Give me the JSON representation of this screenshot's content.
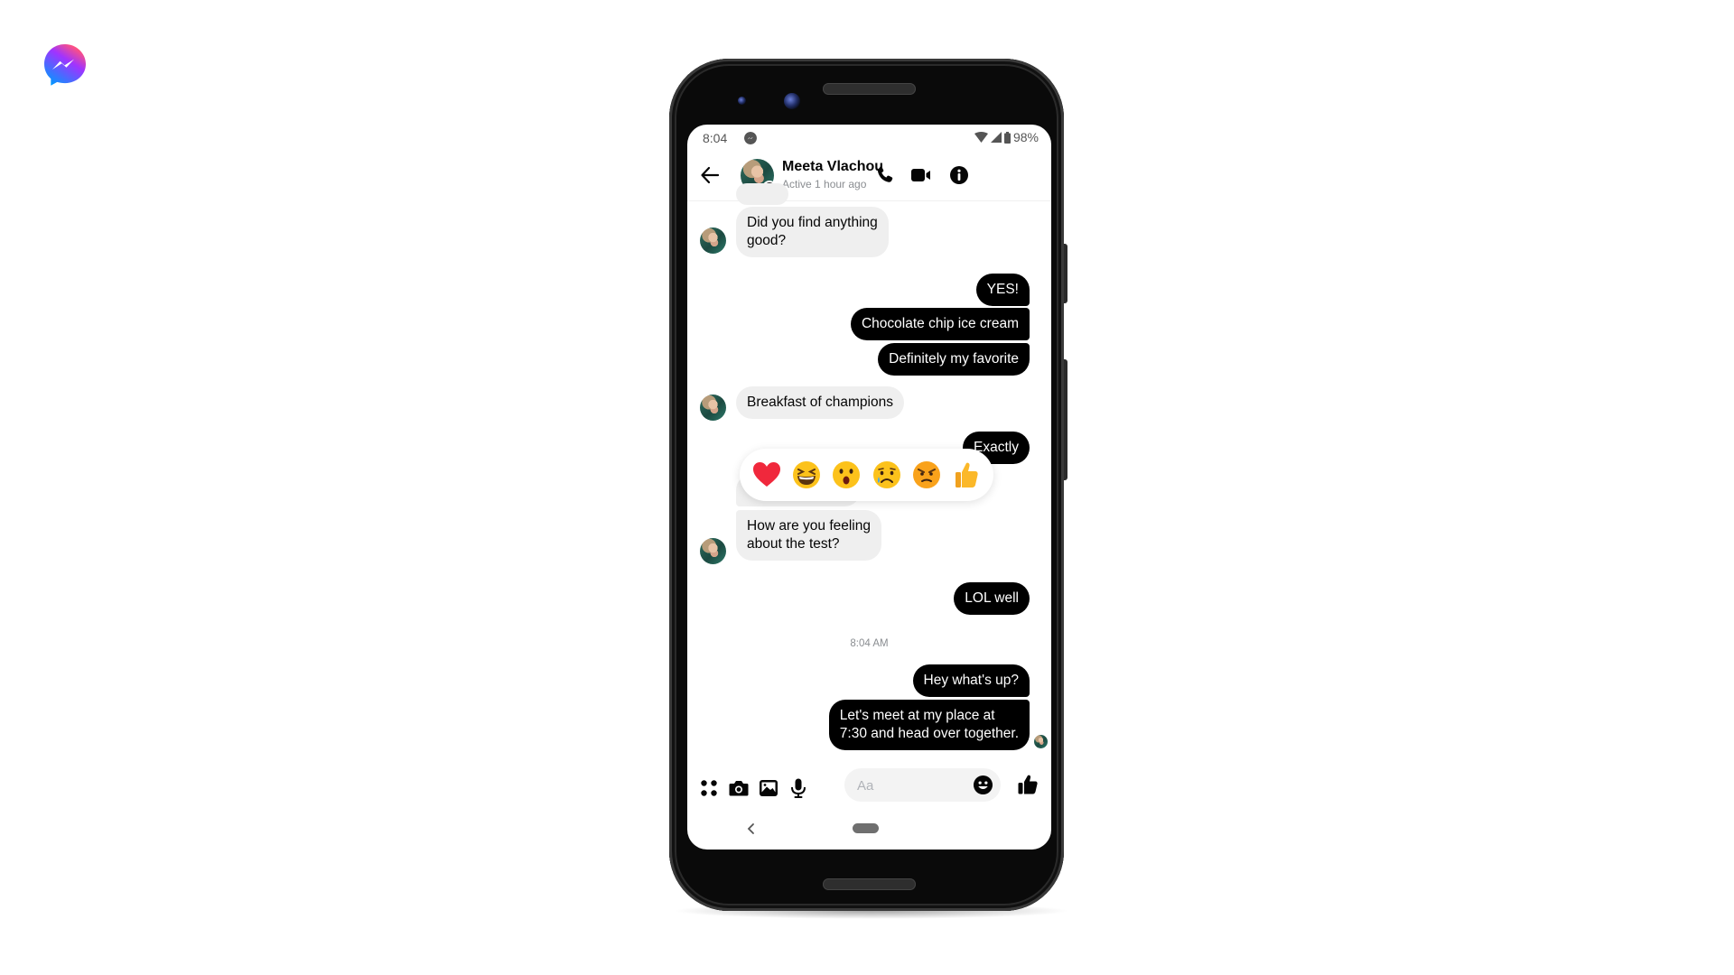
{
  "app": {
    "name": "Messenger",
    "logo_icon": "messenger-logo",
    "brand_colors": [
      "#0099FF",
      "#A033FF",
      "#FF5280",
      "#FF7061"
    ]
  },
  "status_bar": {
    "time": "8:04",
    "notification_icon": "messenger-icon",
    "battery": "98%",
    "wifi_icon": "wifi-icon",
    "signal_icon": "signal-icon",
    "battery_icon": "battery-icon"
  },
  "header": {
    "contact_name": "Meeta Vlachou",
    "status": "Active 1 hour ago",
    "back_icon": "arrow-left-icon",
    "actions": [
      {
        "name": "audio-call",
        "icon": "phone-icon"
      },
      {
        "name": "video-call",
        "icon": "video-camera-icon"
      },
      {
        "name": "conversation-info",
        "icon": "info-icon"
      }
    ]
  },
  "messages": [
    {
      "from": "them",
      "text": "",
      "partial": true
    },
    {
      "from": "them",
      "text": "Did you find anything\ngood?"
    },
    {
      "from": "me",
      "text": "YES!"
    },
    {
      "from": "me",
      "text": "Chocolate chip ice cream"
    },
    {
      "from": "me",
      "text": "Definitely my favorite"
    },
    {
      "from": "them",
      "text": "Breakfast of champions"
    },
    {
      "from": "me",
      "text": "Exactly"
    },
    {
      "from": "them",
      "text": "",
      "partial": true,
      "note": "obscured by reaction picker"
    },
    {
      "from": "them",
      "text": "How are you feeling\nabout the test?"
    },
    {
      "from": "me",
      "text": "LOL well"
    },
    {
      "type": "timestamp",
      "text": "8:04 AM"
    },
    {
      "from": "me",
      "text": "Hey what's up?"
    },
    {
      "from": "me",
      "text": "Let's meet at my place at\n7:30 and head over together.",
      "read_receipt": true
    }
  ],
  "reaction_picker": {
    "reactions": [
      {
        "name": "love",
        "emoji": "❤️"
      },
      {
        "name": "haha",
        "emoji": "😆"
      },
      {
        "name": "wow",
        "emoji": "😮"
      },
      {
        "name": "sad",
        "emoji": "😥"
      },
      {
        "name": "angry",
        "emoji": "😠"
      },
      {
        "name": "like",
        "emoji": "👍"
      }
    ]
  },
  "composer": {
    "placeholder": "Aa",
    "value": "",
    "actions": [
      {
        "name": "more-actions",
        "icon": "four-dots-icon"
      },
      {
        "name": "camera",
        "icon": "camera-icon"
      },
      {
        "name": "gallery",
        "icon": "image-icon"
      },
      {
        "name": "voice",
        "icon": "microphone-icon"
      }
    ],
    "emoji_icon": "smiley-icon",
    "send_like_icon": "thumbs-up-icon"
  },
  "nav_bar": {
    "back_icon": "chevron-left-icon",
    "home_icon": "home-pill-icon"
  }
}
